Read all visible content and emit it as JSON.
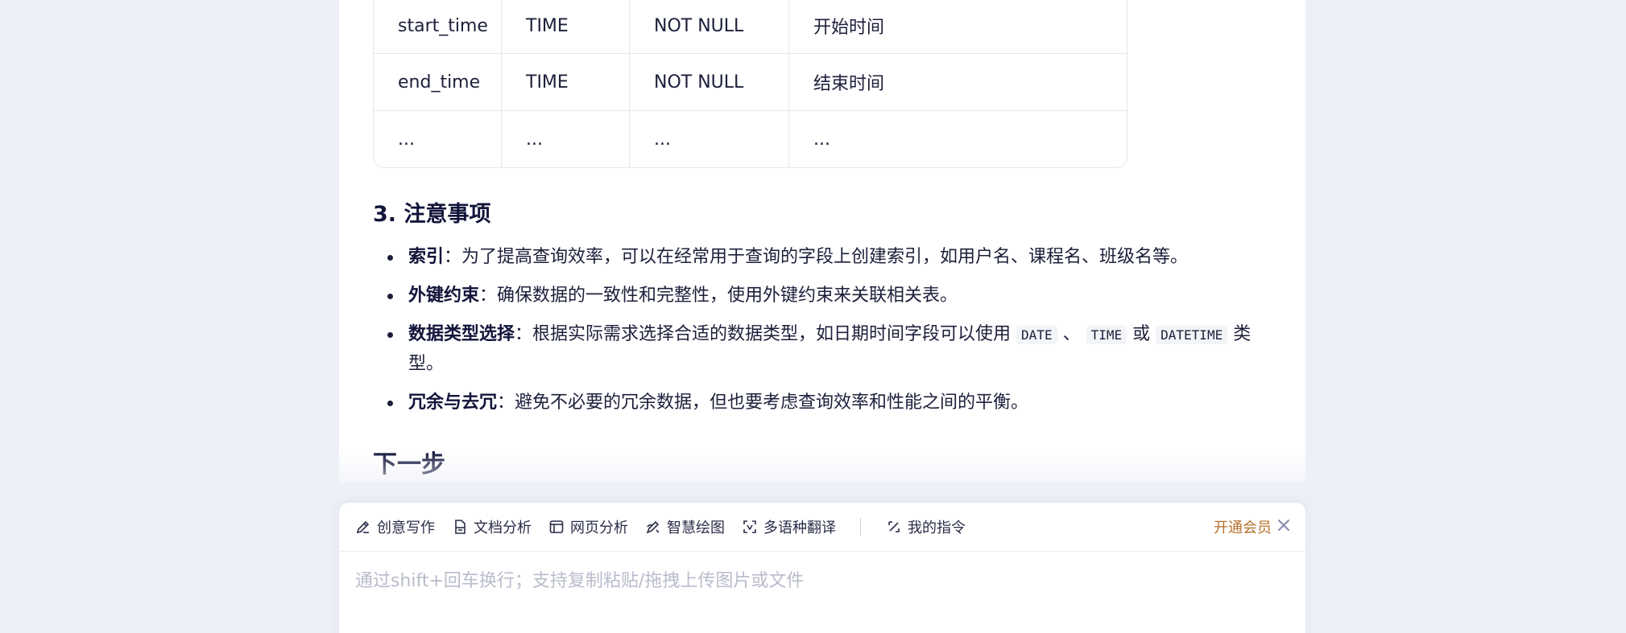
{
  "table": {
    "rows": [
      [
        "start_time",
        "TIME",
        "NOT NULL",
        "开始时间"
      ],
      [
        "end_time",
        "TIME",
        "NOT NULL",
        "结束时间"
      ],
      [
        "...",
        "...",
        "...",
        "..."
      ]
    ]
  },
  "notes_section": {
    "title": "3. 注意事项",
    "items": [
      {
        "term": "索引",
        "sep": "：",
        "text": "为了提高查询效率，可以在经常用于查询的字段上创建索引，如用户名、课程名、班级名等。"
      },
      {
        "term": "外键约束",
        "sep": "：",
        "text": "确保数据的一致性和完整性，使用外键约束来关联相关表。"
      },
      {
        "term": "数据类型选择",
        "sep": "：",
        "text_before": "根据实际需求选择合适的数据类型，如日期时间字段可以使用",
        "code1": "DATE",
        "mid1": "、",
        "code2": "TIME",
        "mid2": "或",
        "code3": "DATETIME",
        "text_after": "类型。"
      },
      {
        "term": "冗余与去冗",
        "sep": "：",
        "text": "避免不必要的冗余数据，但也要考虑查询效率和性能之间的平衡。"
      }
    ]
  },
  "next_heading": "下一步",
  "composer": {
    "tools": [
      {
        "label": "创意写作",
        "icon": "pen-icon"
      },
      {
        "label": "文档分析",
        "icon": "document-icon"
      },
      {
        "label": "网页分析",
        "icon": "webpage-icon"
      },
      {
        "label": "智慧绘图",
        "icon": "brush-icon"
      },
      {
        "label": "多语种翻译",
        "icon": "translate-icon"
      },
      {
        "label": "我的指令",
        "icon": "command-icon"
      }
    ],
    "member_label": "开通会员",
    "placeholder": "通过shift+回车换行；支持复制粘贴/拖拽上传图片或文件"
  },
  "colors": {
    "background": "#eef0f8",
    "text": "#1c1f3a",
    "member_accent": "#b5702a",
    "placeholder": "#b9bccb"
  }
}
